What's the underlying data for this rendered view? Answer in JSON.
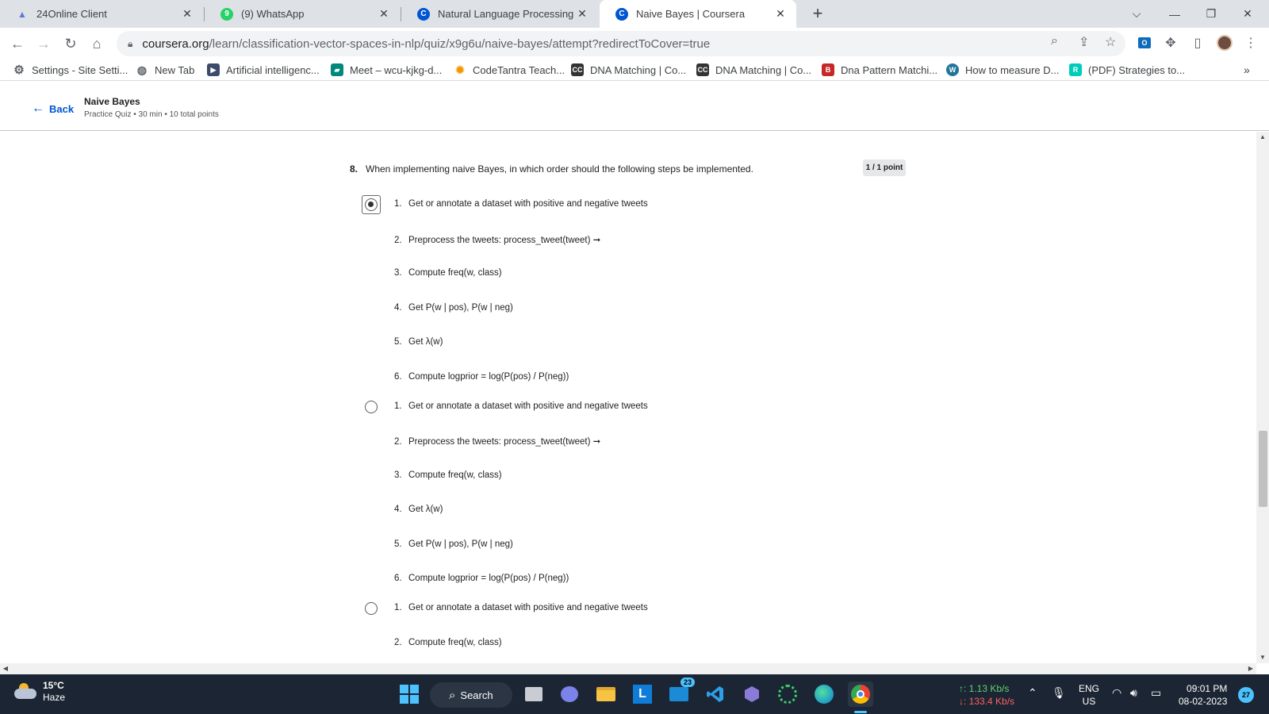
{
  "tabs": [
    {
      "title": "24Online Client",
      "icon": "24online-icon",
      "color": "#5b7bd6",
      "active": false
    },
    {
      "title": "(9) WhatsApp",
      "icon": "whatsapp-icon",
      "color": "#25d366",
      "active": false
    },
    {
      "title": "Natural Language Processing - G",
      "icon": "coursera-icon",
      "color": "#0056d2",
      "active": false
    },
    {
      "title": "Naive Bayes | Coursera",
      "icon": "coursera-icon",
      "color": "#0056d2",
      "active": true
    }
  ],
  "address": {
    "host": "coursera.org",
    "path": "/learn/classification-vector-spaces-in-nlp/quiz/x9g6u/naive-bayes/attempt?redirectToCover=true"
  },
  "bookmarks": [
    {
      "label": "Settings - Site Setti...",
      "icon": "gear-icon",
      "color": "#5f6368"
    },
    {
      "label": "New Tab",
      "icon": "globe-icon",
      "color": "#5f6368"
    },
    {
      "label": "Artificial intelligenc...",
      "icon": "bookmark-icon",
      "color": "#3c4a6b"
    },
    {
      "label": "Meet – wcu-kjkg-d...",
      "icon": "meet-icon",
      "color": "#00897b"
    },
    {
      "label": "CodeTantra Teach...",
      "icon": "codetantra-icon",
      "color": "#f29900"
    },
    {
      "label": "DNA Matching | Co...",
      "icon": "cc-icon",
      "color": "#333333"
    },
    {
      "label": "DNA Matching | Co...",
      "icon": "cc-icon",
      "color": "#333333"
    },
    {
      "label": "Dna Pattern Matchi...",
      "icon": "b-icon",
      "color": "#c62828"
    },
    {
      "label": "How to measure D...",
      "icon": "wordpress-icon",
      "color": "#21759b"
    },
    {
      "label": "(PDF) Strategies to...",
      "icon": "researchgate-icon",
      "color": "#00ccbb"
    }
  ],
  "header": {
    "back_label": "Back",
    "quiz_title": "Naive Bayes",
    "quiz_meta": "Practice Quiz • 30 min • 10 total points"
  },
  "question": {
    "number": "8.",
    "text": "When implementing naive Bayes, in which order should the following steps be implemented.",
    "points": "1 / 1 point",
    "options": [
      {
        "selected": true,
        "steps": [
          {
            "n": "1.",
            "text": "Get or annotate a dataset with positive and negative tweets"
          },
          {
            "n": "2.",
            "text": "Preprocess the tweets: process_tweet(tweet) ➞"
          },
          {
            "n": "3.",
            "text": "Compute freq(w, class)"
          },
          {
            "n": "4.",
            "text": "Get P(w | pos), P(w | neg)"
          },
          {
            "n": "5.",
            "text": "Get λ(w)"
          },
          {
            "n": "6.",
            "text": "Compute logprior = log(P(pos) / P(neg))"
          }
        ]
      },
      {
        "selected": false,
        "steps": [
          {
            "n": "1.",
            "text": "Get or annotate a dataset with positive and negative tweets"
          },
          {
            "n": "2.",
            "text": "Preprocess the tweets: process_tweet(tweet) ➞"
          },
          {
            "n": "3.",
            "text": "Compute freq(w, class)"
          },
          {
            "n": "4.",
            "text": "Get λ(w)"
          },
          {
            "n": "5.",
            "text": "Get P(w | pos), P(w | neg)"
          },
          {
            "n": "6.",
            "text": "Compute logprior = log(P(pos) / P(neg))"
          }
        ]
      },
      {
        "selected": false,
        "steps": [
          {
            "n": "1.",
            "text": "Get or annotate a dataset with positive and negative tweets"
          },
          {
            "n": "2.",
            "text": "Compute freq(w, class)"
          }
        ]
      }
    ]
  },
  "taskbar": {
    "weather_temp": "15°C",
    "weather_cond": "Haze",
    "search_label": "Search",
    "mail_badge": "23",
    "net_up": "↑: 1.13 Kb/s",
    "net_down": "↓: 133.4 Kb/s",
    "lang": "ENG",
    "region": "US",
    "time": "09:01 PM",
    "date": "08-02-2023",
    "notif_count": "27"
  }
}
